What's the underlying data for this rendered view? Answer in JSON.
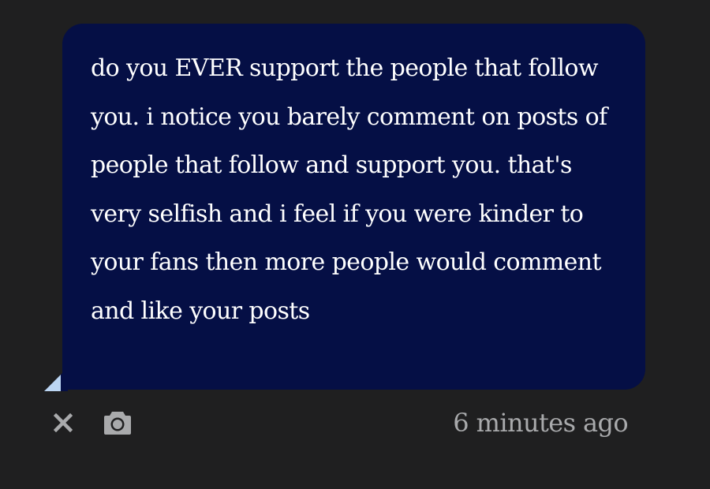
{
  "message": {
    "text": "do you EVER support the people that follow you. i notice you barely comment on posts of people that follow and support you. that's very selfish and i feel if you were kinder to your fans then more people would comment and like your posts"
  },
  "footer": {
    "timestamp": "6 minutes ago",
    "close_icon": "close-icon",
    "camera_icon": "camera-icon"
  },
  "colors": {
    "background": "#1f1f20",
    "bubble": "#050f45",
    "tail_accent": "#bcd6f3",
    "icon": "#a9aaac",
    "text": "#ffffff"
  }
}
